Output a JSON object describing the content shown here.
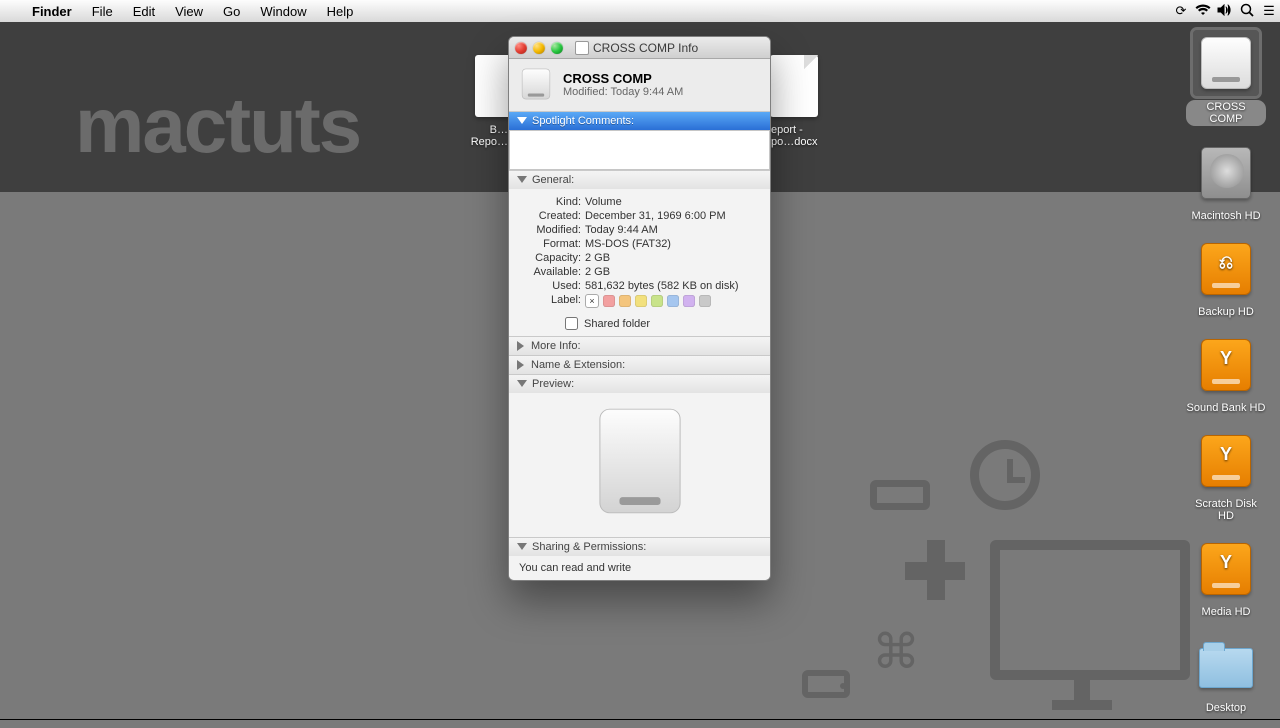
{
  "menubar": {
    "app": "Finder",
    "items": [
      "File",
      "Edit",
      "View",
      "Go",
      "Window",
      "Help"
    ]
  },
  "brand": "mactuts",
  "desktop_docs": {
    "left_partial": "B…\nRepo…",
    "right_label": "…eport -\n…po…docx"
  },
  "info_window": {
    "title": "CROSS COMP Info",
    "name": "CROSS COMP",
    "modified_header": "Modified: Today 9:44 AM",
    "sections": {
      "spotlight": "Spotlight Comments:",
      "general": "General:",
      "more_info": "More Info:",
      "name_ext": "Name & Extension:",
      "preview": "Preview:",
      "sharing": "Sharing & Permissions:"
    },
    "general": {
      "kind_k": "Kind:",
      "kind_v": "Volume",
      "created_k": "Created:",
      "created_v": "December 31, 1969 6:00 PM",
      "modified_k": "Modified:",
      "modified_v": "Today 9:44 AM",
      "format_k": "Format:",
      "format_v": "MS-DOS (FAT32)",
      "capacity_k": "Capacity:",
      "capacity_v": "2 GB",
      "available_k": "Available:",
      "available_v": "2 GB",
      "used_k": "Used:",
      "used_v": "581,632 bytes (582 KB on disk)",
      "label_k": "Label:",
      "shared_folder": "Shared folder"
    },
    "label_colors": [
      "#f2a0a0",
      "#f4c57d",
      "#f2e07d",
      "#c8e38a",
      "#a5c6ef",
      "#d1b2ef",
      "#c9c9c9"
    ],
    "sharing_text": "You can read and write"
  },
  "desktop_items": [
    {
      "label": "CROSS COMP",
      "type": "ext",
      "selected": true
    },
    {
      "label": "Macintosh HD",
      "type": "int"
    },
    {
      "label": "Backup HD",
      "type": "fw",
      "sym": "⎌"
    },
    {
      "label": "Sound Bank HD",
      "type": "fw",
      "sym": "Y"
    },
    {
      "label": "Scratch Disk HD",
      "type": "fw",
      "sym": "Y"
    },
    {
      "label": "Media HD",
      "type": "fw",
      "sym": "Y"
    },
    {
      "label": "Desktop",
      "type": "folder"
    }
  ]
}
